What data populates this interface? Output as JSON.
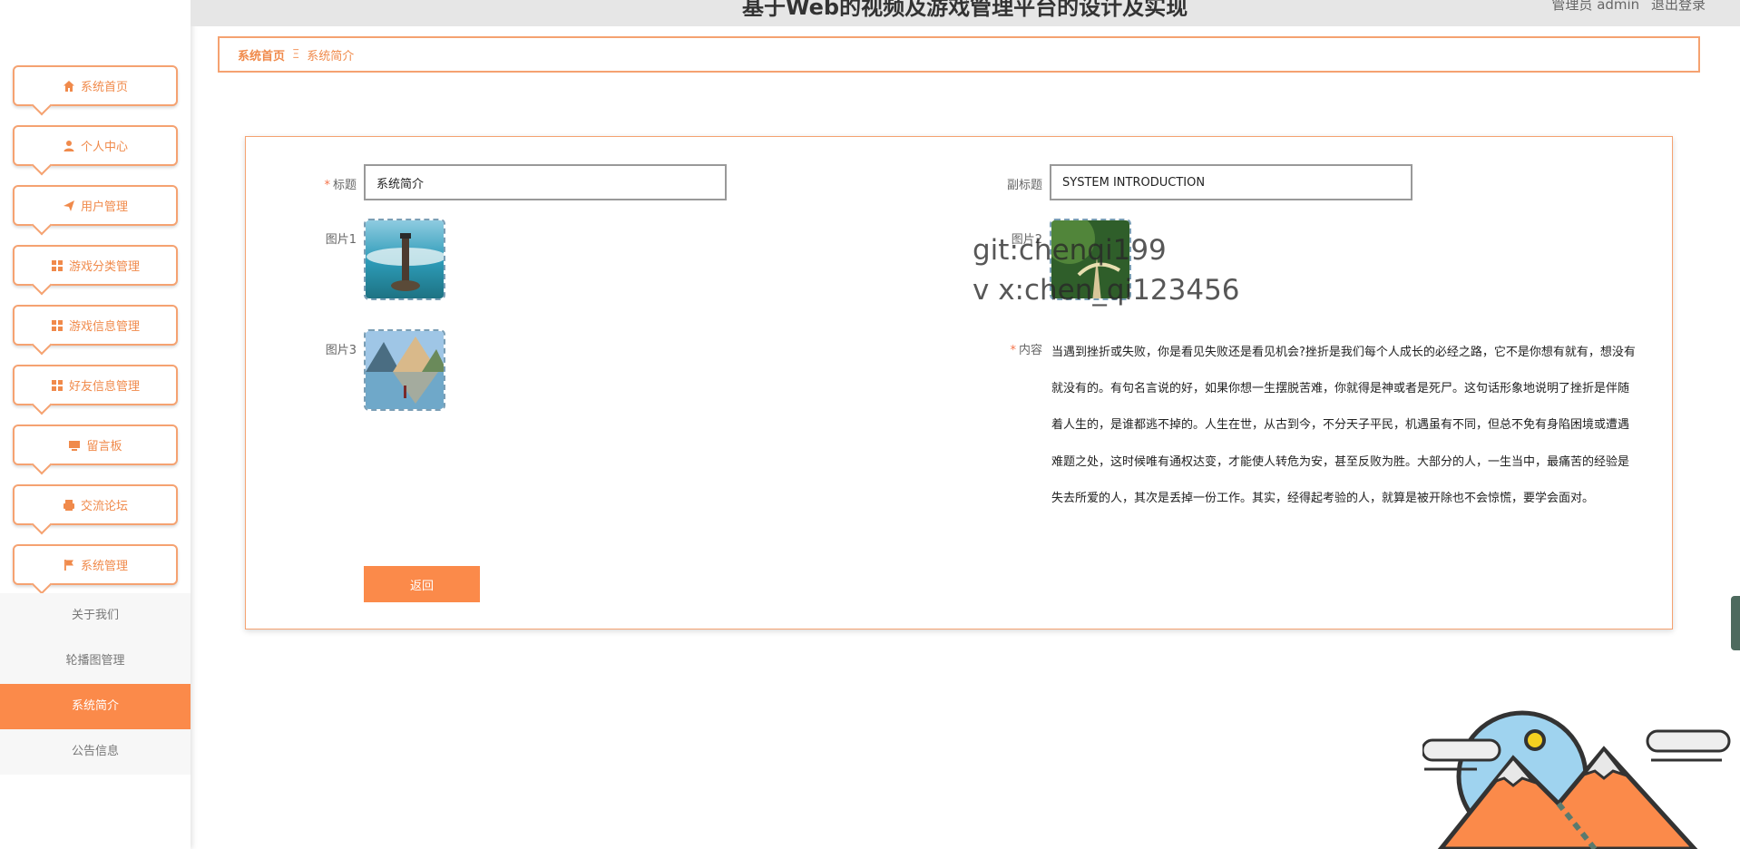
{
  "header": {
    "title": "基于Web的视频及游戏管理平台的设计及实现",
    "user_label": "管理员 admin",
    "logout_label": "退出登录"
  },
  "sidebar": {
    "items": [
      {
        "label": "系统首页",
        "icon": "home-icon"
      },
      {
        "label": "个人中心",
        "icon": "user-icon"
      },
      {
        "label": "用户管理",
        "icon": "send-icon"
      },
      {
        "label": "游戏分类管理",
        "icon": "grid-icon"
      },
      {
        "label": "游戏信息管理",
        "icon": "grid-icon"
      },
      {
        "label": "好友信息管理",
        "icon": "grid-icon"
      },
      {
        "label": "留言板",
        "icon": "monitor-icon"
      },
      {
        "label": "交流论坛",
        "icon": "printer-icon"
      },
      {
        "label": "系统管理",
        "icon": "flag-icon"
      }
    ],
    "submenu": [
      {
        "label": "关于我们",
        "active": false
      },
      {
        "label": "轮播图管理",
        "active": false
      },
      {
        "label": "系统简介",
        "active": true
      },
      {
        "label": "公告信息",
        "active": false
      }
    ]
  },
  "breadcrumb": {
    "home": "系统首页",
    "separator": "Ξ",
    "current": "系统简介"
  },
  "form": {
    "title_label": "标题",
    "title_value": "系统简介",
    "subtitle_label": "副标题",
    "subtitle_value": "SYSTEM INTRODUCTION",
    "image1_label": "图片1",
    "image2_label": "图片2",
    "image3_label": "图片3",
    "content_label": "内容",
    "content_value": "当遇到挫折或失败，你是看见失败还是看见机会?挫折是我们每个人成长的必经之路，它不是你想有就有，想没有就没有的。有句名言说的好，如果你想一生摆脱苦难，你就得是神或者是死尸。这句话形象地说明了挫折是伴随着人生的，是谁都逃不掉的。人生在世，从古到今，不分天子平民，机遇虽有不同，但总不免有身陷困境或遭遇难题之处，这时候唯有通权达变，才能使人转危为安，甚至反败为胜。大部分的人，一生当中，最痛苦的经验是失去所爱的人，其次是丢掉一份工作。其实，经得起考验的人，就算是被开除也不会惊慌，要学会面对。",
    "back_label": "返回"
  },
  "watermark": {
    "line1": "git:chenqi199",
    "line2": "v x:chen_qi123456"
  },
  "colors": {
    "accent": "#fb8a4a",
    "border": "#f5a271"
  }
}
